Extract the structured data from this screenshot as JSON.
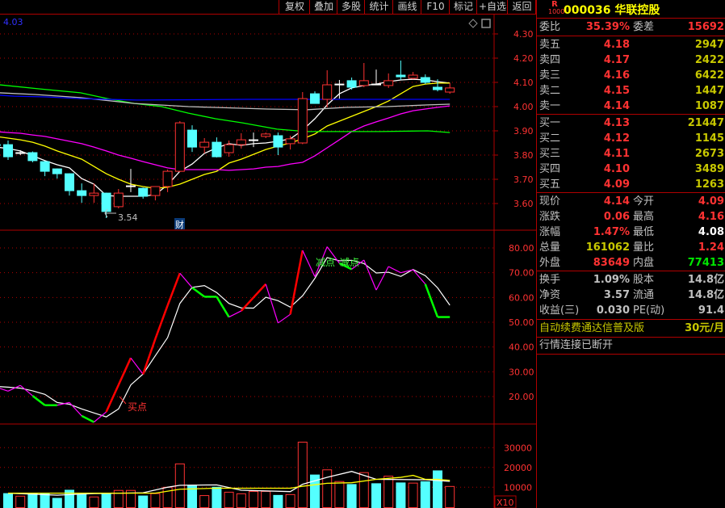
{
  "toolbar": {
    "buttons": [
      "复权",
      "叠加",
      "多股",
      "统计",
      "画线",
      "F10",
      "标记",
      "+自选",
      "返回"
    ]
  },
  "chart": {
    "top_left_value": "4.03",
    "price_axis": [
      "4.30",
      "4.20",
      "4.10",
      "4.00",
      "3.90",
      "3.80",
      "3.70",
      "3.60"
    ],
    "price_axis_values": [
      4.3,
      4.2,
      4.1,
      4.0,
      3.9,
      3.8,
      3.7,
      3.6
    ],
    "low_marker": "3.54",
    "finance_badge": "财",
    "indicator_axis": [
      "80.00",
      "70.00",
      "60.00",
      "50.00",
      "40.00",
      "30.00",
      "20.00"
    ],
    "indicator_axis_values": [
      80,
      70,
      60,
      50,
      40,
      30,
      20
    ],
    "buy_label": "买点",
    "sell_labels": [
      "减点",
      "减点"
    ],
    "volume_axis": [
      "30000",
      "20000",
      "10000"
    ],
    "volume_axis_values": [
      30000,
      20000,
      10000
    ],
    "volume_unit": "X10",
    "colors": {
      "up": "#ff3232",
      "down": "#54ffff",
      "flat": "#ffffff",
      "grid": "#b00000"
    }
  },
  "chart_data": {
    "type": "candlestick",
    "candles": [
      [
        3.843,
        3.85,
        3.835,
        3.84
      ],
      [
        3.843,
        3.86,
        3.78,
        3.793
      ],
      [
        3.81,
        3.82,
        3.8,
        3.81
      ],
      [
        3.81,
        3.815,
        3.77,
        3.777
      ],
      [
        3.773,
        3.775,
        3.713,
        3.733
      ],
      [
        3.743,
        3.745,
        3.703,
        3.723
      ],
      [
        3.723,
        3.725,
        3.633,
        3.653
      ],
      [
        3.653,
        3.683,
        3.603,
        3.633
      ],
      [
        3.633,
        3.683,
        3.603,
        3.643
      ],
      [
        3.643,
        3.645,
        3.54,
        3.567
      ],
      [
        3.587,
        3.66,
        3.58,
        3.643
      ],
      [
        3.673,
        3.743,
        3.647,
        3.673
      ],
      [
        3.663,
        3.666,
        3.62,
        3.63
      ],
      [
        3.633,
        3.653,
        3.613,
        3.67
      ],
      [
        3.67,
        3.74,
        3.647,
        3.733
      ],
      [
        3.733,
        3.94,
        3.73,
        3.933
      ],
      [
        3.903,
        3.923,
        3.813,
        3.833
      ],
      [
        3.833,
        3.87,
        3.807,
        3.853
      ],
      [
        3.853,
        3.873,
        3.79,
        3.793
      ],
      [
        3.81,
        3.86,
        3.793,
        3.843
      ],
      [
        3.843,
        3.89,
        3.827,
        3.863
      ],
      [
        3.863,
        3.893,
        3.833,
        3.863
      ],
      [
        3.877,
        3.893,
        3.87,
        3.887
      ],
      [
        3.88,
        3.893,
        3.8,
        3.833
      ],
      [
        3.847,
        3.88,
        3.823,
        3.867
      ],
      [
        3.85,
        4.06,
        3.845,
        4.033
      ],
      [
        4.053,
        4.063,
        4.013,
        4.013
      ],
      [
        4.03,
        4.15,
        3.997,
        4.09
      ],
      [
        4.093,
        4.11,
        4.033,
        4.093
      ],
      [
        4.107,
        4.12,
        4.07,
        4.08
      ],
      [
        4.087,
        4.18,
        4.08,
        4.107
      ],
      [
        4.093,
        4.153,
        4.09,
        4.093
      ],
      [
        4.087,
        4.137,
        4.077,
        4.107
      ],
      [
        4.13,
        4.19,
        4.11,
        4.123
      ],
      [
        4.117,
        4.143,
        4.113,
        4.13
      ],
      [
        4.12,
        4.133,
        4.093,
        4.1
      ],
      [
        4.08,
        4.113,
        4.063,
        4.07
      ],
      [
        4.06,
        4.097,
        4.053,
        4.077
      ]
    ],
    "ma_lines": [
      {
        "name": "MA5",
        "color": "#ffffff",
        "values": [
          3.833,
          3.827,
          3.817,
          3.797,
          3.777,
          3.76,
          3.747,
          3.703,
          3.68,
          3.633,
          3.63,
          3.63,
          3.63,
          3.637,
          3.677,
          3.733,
          3.763,
          3.807,
          3.83,
          3.847,
          3.84,
          3.847,
          3.85,
          3.857,
          3.867,
          3.903,
          3.95,
          4.007,
          4.053,
          4.077,
          4.087,
          4.093,
          4.103,
          4.11,
          4.113,
          4.11,
          4.103,
          4.097
        ]
      },
      {
        "name": "MA10",
        "color": "#ffff00",
        "values": [
          3.877,
          3.87,
          3.863,
          3.853,
          3.837,
          3.817,
          3.8,
          3.783,
          3.753,
          3.723,
          3.7,
          3.68,
          3.67,
          3.663,
          3.667,
          3.68,
          3.7,
          3.72,
          3.733,
          3.767,
          3.783,
          3.803,
          3.823,
          3.837,
          3.85,
          3.867,
          3.887,
          3.92,
          3.94,
          3.96,
          3.98,
          4.0,
          4.023,
          4.053,
          4.083,
          4.093,
          4.097,
          4.097
        ]
      },
      {
        "name": "MA20",
        "color": "#ff00ff",
        "values": [
          3.897,
          3.893,
          3.89,
          3.883,
          3.877,
          3.867,
          3.857,
          3.847,
          3.833,
          3.817,
          3.8,
          3.787,
          3.773,
          3.76,
          3.747,
          3.74,
          3.74,
          3.74,
          3.74,
          3.737,
          3.74,
          3.743,
          3.75,
          3.753,
          3.763,
          3.77,
          3.797,
          3.83,
          3.863,
          3.897,
          3.92,
          3.937,
          3.953,
          3.97,
          3.983,
          3.99,
          3.997,
          4.003
        ]
      },
      {
        "name": "MA30",
        "color": "#00ff00",
        "points": [
          [
            0.3,
            4.09
          ],
          [
            3.6,
            4.073
          ],
          [
            6.9,
            4.057
          ],
          [
            9.1,
            4.033
          ],
          [
            11.3,
            4.013
          ],
          [
            13.5,
            4.0
          ],
          [
            15.7,
            3.973
          ],
          [
            17.9,
            3.95
          ],
          [
            20.1,
            3.933
          ],
          [
            22.9,
            3.907
          ],
          [
            25.3,
            3.897
          ],
          [
            31.3,
            3.897
          ],
          [
            35.2,
            3.9
          ],
          [
            37,
            3.893
          ]
        ]
      },
      {
        "name": "MA60",
        "color": "#c0c0c0",
        "points": [
          [
            0.3,
            4.057
          ],
          [
            3.2,
            4.05
          ],
          [
            6.9,
            4.037
          ],
          [
            11.3,
            4.013
          ],
          [
            15.7,
            4.0
          ],
          [
            22.1,
            3.99
          ],
          [
            25.3,
            3.987
          ],
          [
            28.6,
            3.997
          ],
          [
            31.9,
            4.0
          ],
          [
            35.2,
            4.007
          ],
          [
            37,
            4.01
          ]
        ]
      },
      {
        "name": "MA120",
        "color": "#0000ff",
        "points": [
          [
            0.3,
            4.047
          ],
          [
            1.5,
            4.043
          ],
          [
            4.1,
            4.04
          ],
          [
            6.9,
            4.033
          ],
          [
            11.5,
            4.027
          ],
          [
            20.5,
            4.03
          ],
          [
            37,
            4.03
          ]
        ]
      }
    ],
    "indicator": {
      "fast": [
        23.8,
        22.2,
        24.5,
        20.3,
        16.5,
        16.5,
        17.6,
        12.2,
        9.7,
        13.8,
        24.7,
        35.6,
        29.0,
        43.3,
        56.8,
        69.8,
        64.0,
        60.3,
        60.3,
        52.1,
        54.6,
        60.0,
        65.4,
        49.7,
        53.2,
        79.0,
        68.4,
        80.5,
        73.8,
        71.4,
        75.1,
        63.0,
        72.5,
        70.0,
        71.2,
        65.4,
        52.1,
        52.1
      ],
      "fast_segment_colors": [
        "m",
        "m",
        "m",
        "g",
        "g",
        "m",
        "m",
        "g",
        "m",
        "r",
        "r",
        "m",
        "r",
        "r",
        "r",
        "m",
        "g",
        "g",
        "g",
        "m",
        "r",
        "r",
        "m",
        "m",
        "r",
        "m",
        "m",
        "m",
        "g",
        "m",
        "m",
        "m",
        "m",
        "m",
        "m",
        "g",
        "g"
      ],
      "slow": [
        24.1,
        23.8,
        23.4,
        22.3,
        20.9,
        17.6,
        16.9,
        15.0,
        13.4,
        11.8,
        15.0,
        24.7,
        29.1,
        36.5,
        43.8,
        57.6,
        64.1,
        64.8,
        62.0,
        57.6,
        55.8,
        55.7,
        60.1,
        58.7,
        56.1,
        60.7,
        67.7,
        76.1,
        74.8,
        75.0,
        73.7,
        69.9,
        70.2,
        68.5,
        71.3,
        68.8,
        63.9,
        56.9
      ],
      "ylim": [
        0,
        90
      ]
    },
    "volume": {
      "values": [
        6800,
        5500,
        6800,
        7000,
        4400,
        8500,
        6300,
        5100,
        7000,
        8400,
        8400,
        5600,
        6800,
        10000,
        21800,
        11000,
        5800,
        10000,
        7500,
        6700,
        7900,
        7900,
        5900,
        6300,
        32800,
        16200,
        18800,
        12900,
        11400,
        17400,
        11800,
        15600,
        12200,
        12100,
        12800,
        18300,
        10400
      ],
      "up": [
        false,
        true,
        false,
        false,
        false,
        false,
        false,
        true,
        false,
        true,
        true,
        false,
        true,
        true,
        true,
        false,
        true,
        false,
        true,
        true,
        true,
        true,
        false,
        true,
        true,
        false,
        true,
        true,
        false,
        true,
        false,
        true,
        false,
        true,
        false,
        false,
        true
      ],
      "ma_white": [
        [
          1,
          7000
        ],
        [
          5,
          6000
        ],
        [
          8,
          6800
        ],
        [
          12,
          7200
        ],
        [
          14,
          10000
        ],
        [
          15,
          11000
        ],
        [
          18,
          11200
        ],
        [
          20,
          8500
        ],
        [
          24,
          7800
        ],
        [
          25,
          11500
        ],
        [
          27,
          15000
        ],
        [
          29,
          18000
        ],
        [
          31,
          14000
        ],
        [
          35,
          13800
        ],
        [
          37,
          13000
        ]
      ],
      "ma_yellow": [
        [
          1,
          7000
        ],
        [
          13,
          7000
        ],
        [
          15,
          9000
        ],
        [
          18,
          9500
        ],
        [
          24,
          9500
        ],
        [
          25,
          10500
        ],
        [
          27,
          12000
        ],
        [
          29,
          12300
        ],
        [
          31,
          14000
        ],
        [
          33,
          15000
        ],
        [
          34,
          16000
        ],
        [
          35,
          14000
        ],
        [
          36,
          14000
        ],
        [
          37,
          13500
        ]
      ]
    }
  },
  "quote": {
    "code_badge_top": "R",
    "code_badge_bottom": "1000",
    "code": "000036",
    "name": "华联控股",
    "weibi_label": "委比",
    "weibi": "35.39%",
    "weicha_label": "委差",
    "weicha": "15692",
    "asks": [
      {
        "label": "卖五",
        "price": "4.18",
        "volume": "2947"
      },
      {
        "label": "卖四",
        "price": "4.17",
        "volume": "2422"
      },
      {
        "label": "卖三",
        "price": "4.16",
        "volume": "6422"
      },
      {
        "label": "卖二",
        "price": "4.15",
        "volume": "1447"
      },
      {
        "label": "卖一",
        "price": "4.14",
        "volume": "1087"
      }
    ],
    "bids": [
      {
        "label": "买一",
        "price": "4.13",
        "volume": "21447"
      },
      {
        "label": "买二",
        "price": "4.12",
        "volume": "1145"
      },
      {
        "label": "买三",
        "price": "4.11",
        "volume": "2673"
      },
      {
        "label": "买四",
        "price": "4.10",
        "volume": "3489"
      },
      {
        "label": "买五",
        "price": "4.09",
        "volume": "1263"
      }
    ],
    "stats": [
      {
        "l1": "现价",
        "v1": "4.14",
        "c1": "red",
        "l2": "今开",
        "v2": "4.09",
        "c2": "red"
      },
      {
        "l1": "涨跌",
        "v1": "0.06",
        "c1": "red",
        "l2": "最高",
        "v2": "4.16",
        "c2": "red"
      },
      {
        "l1": "涨幅",
        "v1": "1.47%",
        "c1": "red",
        "l2": "最低",
        "v2": "4.08",
        "c2": "wht"
      },
      {
        "l1": "总量",
        "v1": "161062",
        "c1": "yel",
        "l2": "量比",
        "v2": "1.24",
        "c2": "red"
      },
      {
        "l1": "外盘",
        "v1": "83649",
        "c1": "red",
        "l2": "内盘",
        "v2": "77413",
        "c2": "grn"
      }
    ],
    "fundamentals": [
      {
        "l1": "换手",
        "v1": "1.09%",
        "l2": "股本",
        "v2": "14.8亿"
      },
      {
        "l1": "净资",
        "v1": "3.57",
        "l2": "流通",
        "v2": "14.8亿"
      },
      {
        "l1": "收益(三)",
        "v1": "0.030",
        "l2": "PE(动)",
        "v2": "91.4"
      }
    ],
    "ad_text": "自动续费通达信普及版",
    "ad_price": "30元/月",
    "status": "行情连接已断开"
  }
}
